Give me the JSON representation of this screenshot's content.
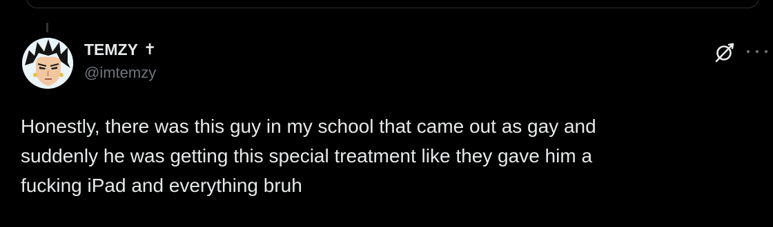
{
  "tweet": {
    "display_name": "TEMZY",
    "name_badge": "✝",
    "handle": "@imtemzy",
    "text": "Honestly, there was this guy in my school that came out as gay and\nsuddenly he was getting this special treatment like they gave him a\nfucking iPad and everything bruh"
  },
  "icons": {
    "grok": "grok-icon",
    "more": "more-options-icon",
    "avatar": "avatar"
  },
  "colors": {
    "background": "#000000",
    "text_primary": "#e7e9ea",
    "text_secondary": "#71767b",
    "border": "#2f3336"
  }
}
